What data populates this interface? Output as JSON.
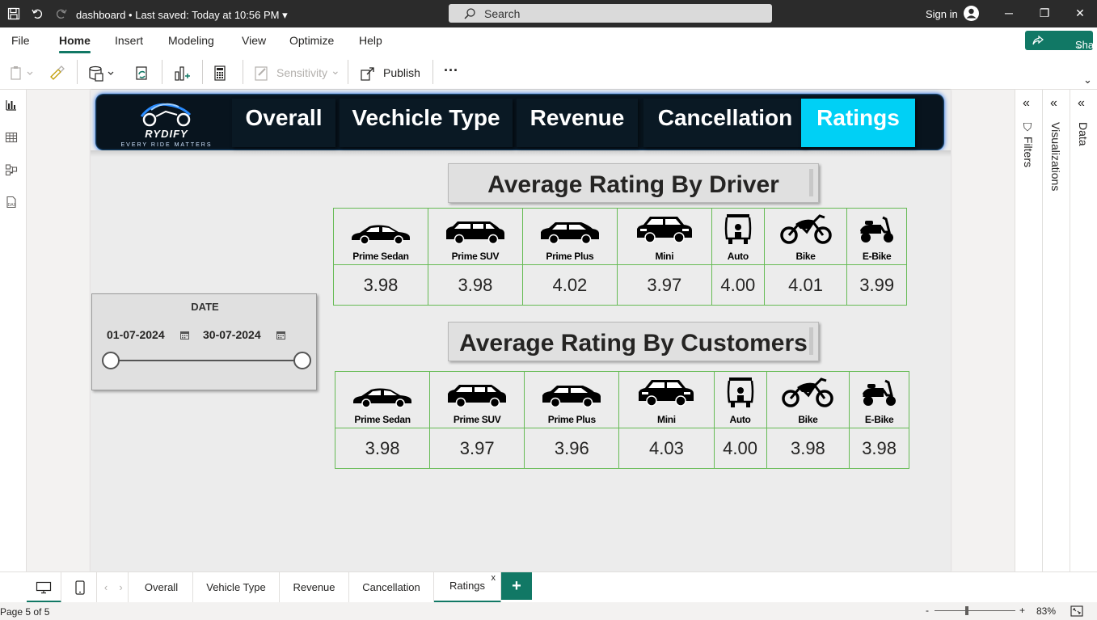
{
  "titlebar": {
    "title": "dashboard • Last saved: Today at 10:56 PM",
    "search_placeholder": "Search",
    "signin": "Sign in"
  },
  "menu": {
    "items": [
      "File",
      "Home",
      "Insert",
      "Modeling",
      "View",
      "Optimize",
      "Help"
    ],
    "active": "Home",
    "share_label": "Share"
  },
  "toolbar": {
    "sensitivity_label": "Sensitivity",
    "publish_label": "Publish",
    "more_label": "···"
  },
  "panes": {
    "filters": "Filters",
    "visualizations": "Visualizations",
    "data": "Data"
  },
  "report": {
    "brand": {
      "name": "RYDIFY",
      "tagline": "EVERY RIDE MATTERS"
    },
    "nav_tabs": [
      "Overall",
      "Vechicle Type",
      "Revenue",
      "Cancellation",
      "Ratings"
    ],
    "active_tab": "Ratings",
    "slicer": {
      "title": "DATE",
      "start": "01-07-2024",
      "end": "30-07-2024"
    },
    "driver_table": {
      "title": "Average Rating By Driver",
      "vehicles": [
        "Prime Sedan",
        "Prime SUV",
        "Prime Plus",
        "Mini",
        "Auto",
        "Bike",
        "E-Bike"
      ],
      "values": [
        "3.98",
        "3.98",
        "4.02",
        "3.97",
        "4.00",
        "4.01",
        "3.99"
      ]
    },
    "customer_table": {
      "title": "Average Rating By Customers",
      "vehicles": [
        "Prime Sedan",
        "Prime SUV",
        "Prime Plus",
        "Mini",
        "Auto",
        "Bike",
        "E-Bike"
      ],
      "values": [
        "3.98",
        "3.97",
        "3.96",
        "4.03",
        "4.00",
        "3.98",
        "3.98"
      ]
    }
  },
  "pages": {
    "tabs": [
      "Overall",
      "Vehicle Type",
      "Revenue",
      "Cancellation",
      "Ratings"
    ],
    "active": "Ratings",
    "close": "x",
    "add": "+"
  },
  "status": {
    "page_info": "Page 5 of 5",
    "zoom": "83%",
    "zoom_minus": "-",
    "zoom_plus": "+"
  },
  "colors": {
    "accent": "#117865",
    "nav_active": "#00d0f5",
    "nav_bg": "#08141e",
    "table_border": "#66bb55"
  }
}
